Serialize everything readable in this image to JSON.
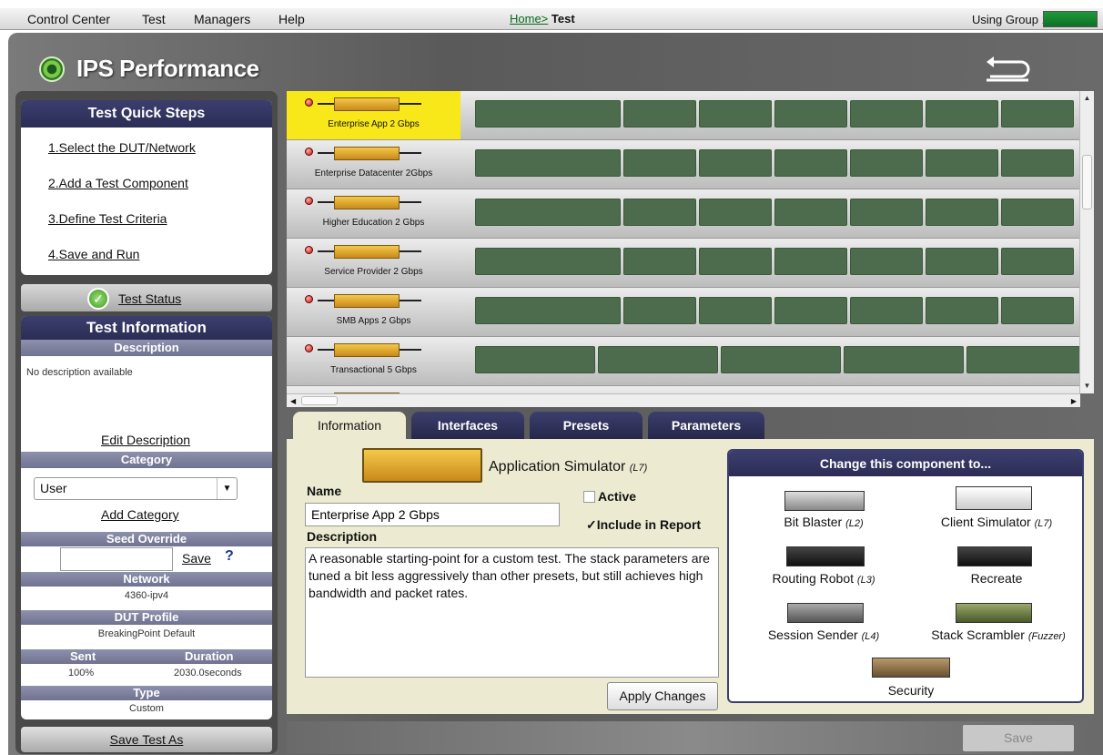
{
  "menubar": {
    "items": [
      "Control Center",
      "Test",
      "Managers",
      "Help"
    ],
    "breadcrumb_home": "Home>",
    "breadcrumb_current": "Test",
    "group_label": "Using Group 1"
  },
  "app": {
    "title": "IPS Performance"
  },
  "quick_steps": {
    "title": "Test Quick Steps",
    "steps": [
      "1.Select the DUT/Network",
      "2.Add a Test Component",
      "3.Define Test Criteria",
      "4.Save and Run"
    ]
  },
  "test_status": {
    "label": "Test Status"
  },
  "test_info": {
    "title": "Test Information",
    "description_head": "Description",
    "description": "No description available",
    "edit_description": "Edit Description",
    "category_head": "Category",
    "category_value": "User",
    "add_category": "Add Category",
    "seed_head": "Seed Override",
    "seed_value": "",
    "seed_save": "Save",
    "help": "?",
    "network_head": "Network",
    "network_value": "4360-ipv4",
    "dut_head": "DUT Profile",
    "dut_value": "BreakingPoint Default",
    "sent_head": "Sent",
    "duration_head": "Duration",
    "sent_value": "100%",
    "duration_value": "2030.0seconds",
    "type_head": "Type",
    "type_value": "Custom"
  },
  "save_test_as": "Save Test As",
  "components": [
    {
      "label": "Enterprise App 2 Gbps",
      "selected": true
    },
    {
      "label": "Enterprise Datacenter 2Gbps",
      "selected": false
    },
    {
      "label": "Higher Education 2 Gbps",
      "selected": false
    },
    {
      "label": "Service Provider 2 Gbps",
      "selected": false
    },
    {
      "label": "SMB Apps 2 Gbps",
      "selected": false
    },
    {
      "label": "Transactional 5 Gbps",
      "selected": false
    },
    {
      "label": "",
      "selected": false
    }
  ],
  "tabs": [
    "Information",
    "Interfaces",
    "Presets",
    "Parameters"
  ],
  "detail": {
    "component_type": "Application Simulator",
    "component_layer": "(L7)",
    "name_label": "Name",
    "name_value": "Enterprise App 2 Gbps",
    "active_label": "Active",
    "active_checked": false,
    "include_label": "Include in Report",
    "include_checked": true,
    "include_mark": "✓",
    "description_label": "Description",
    "description_value": "A reasonable starting-point for a custom test. The stack parameters are tuned a bit less aggressively than other presets, but still achieves high bandwidth and packet rates.",
    "apply": "Apply Changes"
  },
  "change_to": {
    "title": "Change this component to...",
    "options": [
      {
        "name": "Bit Blaster",
        "layer": "(L2)"
      },
      {
        "name": "Client Simulator",
        "layer": "(L7)"
      },
      {
        "name": "Routing Robot",
        "layer": "(L3)"
      },
      {
        "name": "Recreate",
        "layer": ""
      },
      {
        "name": "Session Sender",
        "layer": "(L4)"
      },
      {
        "name": "Stack Scrambler",
        "layer": "(Fuzzer)"
      },
      {
        "name": "Security",
        "layer": ""
      }
    ]
  },
  "footer": {
    "save": "Save"
  },
  "colors": {
    "accent_navy": "#2b2d55",
    "selected_yellow": "#f8e81a",
    "slot_green": "#4d6b4d"
  }
}
